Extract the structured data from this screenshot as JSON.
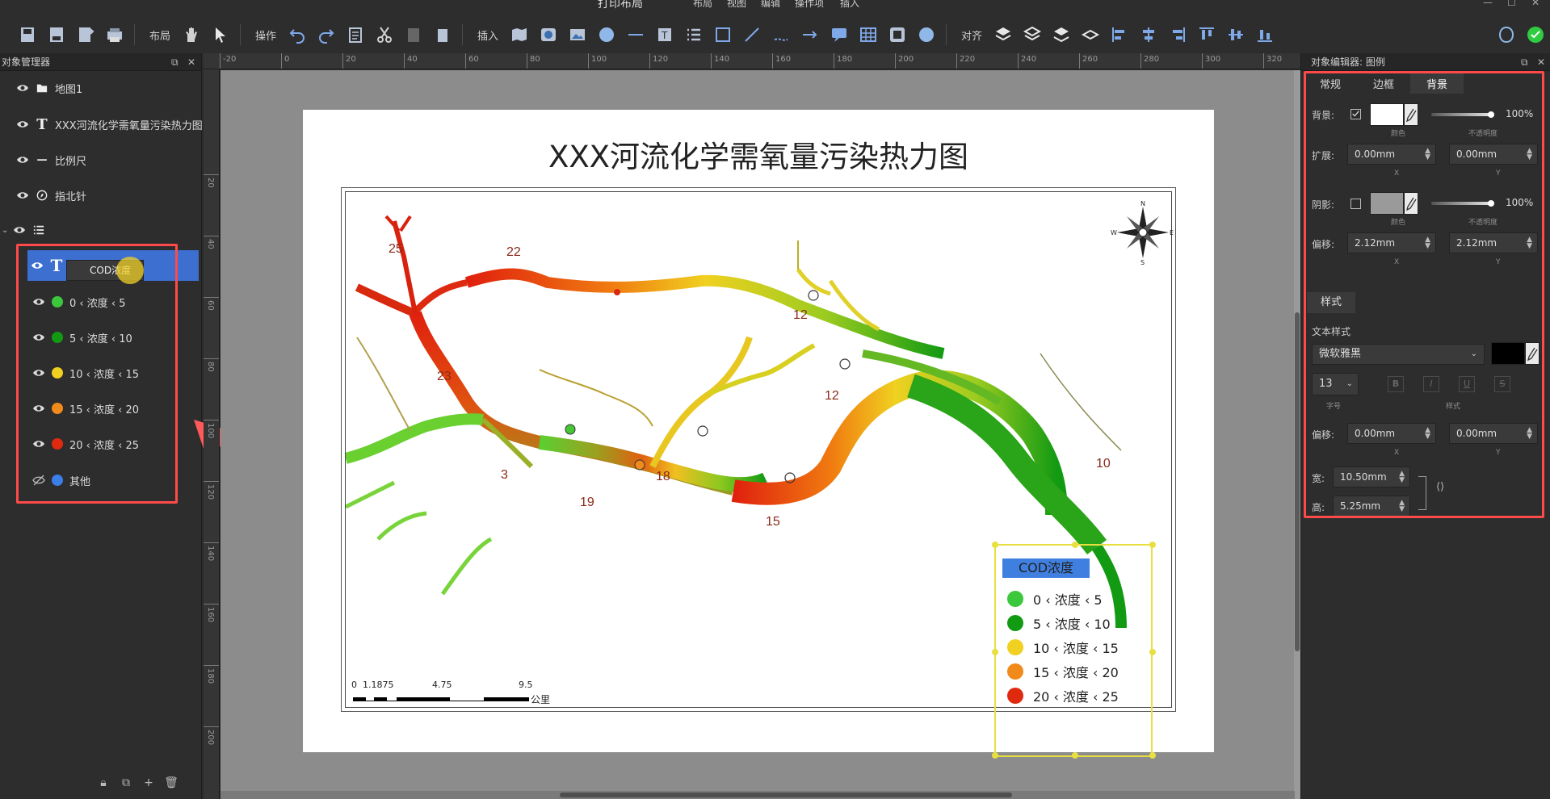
{
  "window": {
    "title": "打印布局",
    "menus": [
      "布局",
      "视图",
      "编辑",
      "操作项",
      "插入"
    ]
  },
  "toolbar": {
    "labels": {
      "layout": "布局",
      "operate": "操作",
      "insert": "插入",
      "align": "对齐"
    }
  },
  "left_panel": {
    "title": "对象管理器",
    "items": [
      {
        "label": "地图1",
        "icon": "folder-icon"
      },
      {
        "label": "XXX河流化学需氧量污染热力图",
        "icon": "T"
      },
      {
        "label": "比例尺",
        "icon": "—"
      },
      {
        "label": "指北针",
        "icon": "compass-icon"
      },
      {
        "label": "",
        "icon": "list-icon"
      }
    ],
    "selected": {
      "icon": "T",
      "value": "COD浓度"
    },
    "legend_items": [
      {
        "label": "0 ‹ 浓度 ‹ 5",
        "color": "#3cc83c"
      },
      {
        "label": "5 ‹ 浓度 ‹ 10",
        "color": "#139a13"
      },
      {
        "label": "10 ‹ 浓度 ‹ 15",
        "color": "#f0d020"
      },
      {
        "label": "15 ‹ 浓度 ‹ 20",
        "color": "#f08a1a"
      },
      {
        "label": "20 ‹ 浓度 ‹ 25",
        "color": "#e02a10"
      },
      {
        "label": "其他",
        "color": "#3a7ee8"
      }
    ]
  },
  "ruler": {
    "h": [
      "-20",
      "0",
      "20",
      "40",
      "60",
      "80",
      "100",
      "120",
      "140",
      "160",
      "180",
      "200",
      "220",
      "240",
      "260",
      "280",
      "300",
      "320"
    ],
    "v": [
      "20",
      "40",
      "60",
      "80",
      "100",
      "120",
      "140",
      "160",
      "180",
      "200"
    ]
  },
  "map": {
    "title": "XXX河流化学需氧量污染热力图",
    "station_labels": [
      "25",
      "22",
      "12",
      "23",
      "12",
      "3",
      "18",
      "19",
      "15",
      "10"
    ],
    "compass": {
      "n": "N",
      "s": "S",
      "e": "E",
      "w": "W"
    },
    "scale": {
      "ticks": [
        "0",
        "1.1875",
        "4.75",
        "9.5"
      ],
      "unit": "公里"
    },
    "legend": {
      "title": "COD浓度",
      "items": [
        {
          "label": "0 ‹ 浓度 ‹ 5",
          "color": "#3cc83c"
        },
        {
          "label": "5 ‹ 浓度 ‹ 10",
          "color": "#139a13"
        },
        {
          "label": "10 ‹ 浓度 ‹ 15",
          "color": "#f0d020"
        },
        {
          "label": "15 ‹ 浓度 ‹ 20",
          "color": "#f08a1a"
        },
        {
          "label": "20 ‹ 浓度 ‹ 25",
          "color": "#e02a10"
        }
      ]
    }
  },
  "right_panel": {
    "title": "对象编辑器: 图例",
    "tabs": [
      "常规",
      "边框",
      "背景"
    ],
    "background": {
      "label": "背景:",
      "checked": true,
      "color_label": "颜色",
      "opacity_label": "不透明度",
      "opacity": "100%"
    },
    "expand": {
      "label": "扩展:",
      "x": "0.00mm",
      "y": "0.00mm",
      "x_label": "X",
      "y_label": "Y"
    },
    "shadow": {
      "label": "阴影:",
      "checked": false,
      "color_label": "颜色",
      "opacity_label": "不透明度",
      "opacity": "100%"
    },
    "offset": {
      "label": "偏移:",
      "x": "2.12mm",
      "y": "2.12mm",
      "x_label": "X",
      "y_label": "Y"
    },
    "style_tab": "样式",
    "text_style": {
      "label": "文本样式",
      "font": "微软雅黑",
      "size": "13",
      "size_label": "字号",
      "style_label": "样式"
    },
    "text_offset": {
      "label": "偏移:",
      "x": "0.00mm",
      "y": "0.00mm",
      "x_label": "X",
      "y_label": "Y"
    },
    "width": {
      "label": "宽:",
      "value": "10.50mm"
    },
    "height": {
      "label": "高:",
      "value": "5.25mm"
    }
  }
}
